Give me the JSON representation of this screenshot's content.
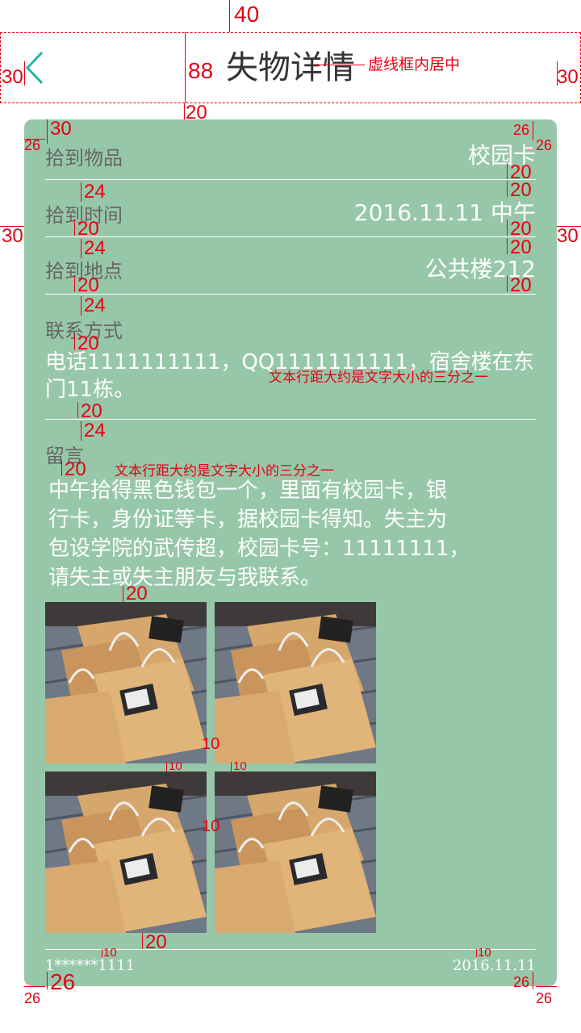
{
  "header": {
    "title": "失物详情",
    "back_icon": "chevron-left-icon",
    "accent": "#1fb8a4"
  },
  "card": {
    "background": "#97c7a9",
    "rows": [
      {
        "label": "拾到物品",
        "value": "校园卡"
      },
      {
        "label": "拾到时间",
        "value": "2016.11.11 中午"
      },
      {
        "label": "拾到地点",
        "value": "公共楼212"
      }
    ],
    "contact": {
      "label": "联系方式",
      "text_line1": "电话1111111111，QQ1111111111，宿舍楼在东",
      "text_line2": "门11栋。"
    },
    "message": {
      "label": "留言",
      "line1": "中午拾得黑色钱包一个，里面有校园卡，银",
      "line2": "行卡，身份证等卡，据校园卡得知。失主为",
      "line3": "包设学院的武传超，校园卡号：11111111，",
      "line4": "请失主或失主朋友与我联系。"
    },
    "photos": [
      "shopping-bags-photo",
      "shopping-bags-photo",
      "shopping-bags-photo",
      "shopping-bags-photo"
    ],
    "footer": {
      "user": "1******1111",
      "date": "2016.11.11"
    }
  },
  "annotations": {
    "top_40": "40",
    "left_30": "30",
    "h_88": "88",
    "right_30": "30",
    "center_note": "虚线框内居中",
    "gap_20": "20",
    "card_30": "30",
    "card_26_left": "26",
    "card_26_r1": "26",
    "card_26_r2": "26",
    "r_20_a": "20",
    "r_24_a": "24",
    "r_20_b": "20",
    "r_20_c": "20",
    "r_30_left": "30",
    "r_30_right": "30",
    "r_24_b": "24",
    "r_20_d": "20",
    "r_20_e": "20",
    "r_20_f": "20",
    "r_20_g": "20",
    "r_24_c": "24",
    "r_20_h": "20",
    "line_note_1": "文本行距大约是文字大小的三分之一",
    "r_20_i": "20",
    "r_24_d": "24",
    "r_20_j": "20",
    "line_note_2": "文本行距大约是文字大小的三分之一",
    "r_20_k": "20",
    "p_10_a": "10",
    "p_10_b": "10",
    "p_10_c": "10",
    "p_10_d": "10",
    "p_20": "20",
    "f_10_a": "10",
    "f_10_b": "10",
    "f_26_a": "26",
    "f_26_b": "26",
    "f_26_c": "26",
    "f_26_d": "26"
  }
}
